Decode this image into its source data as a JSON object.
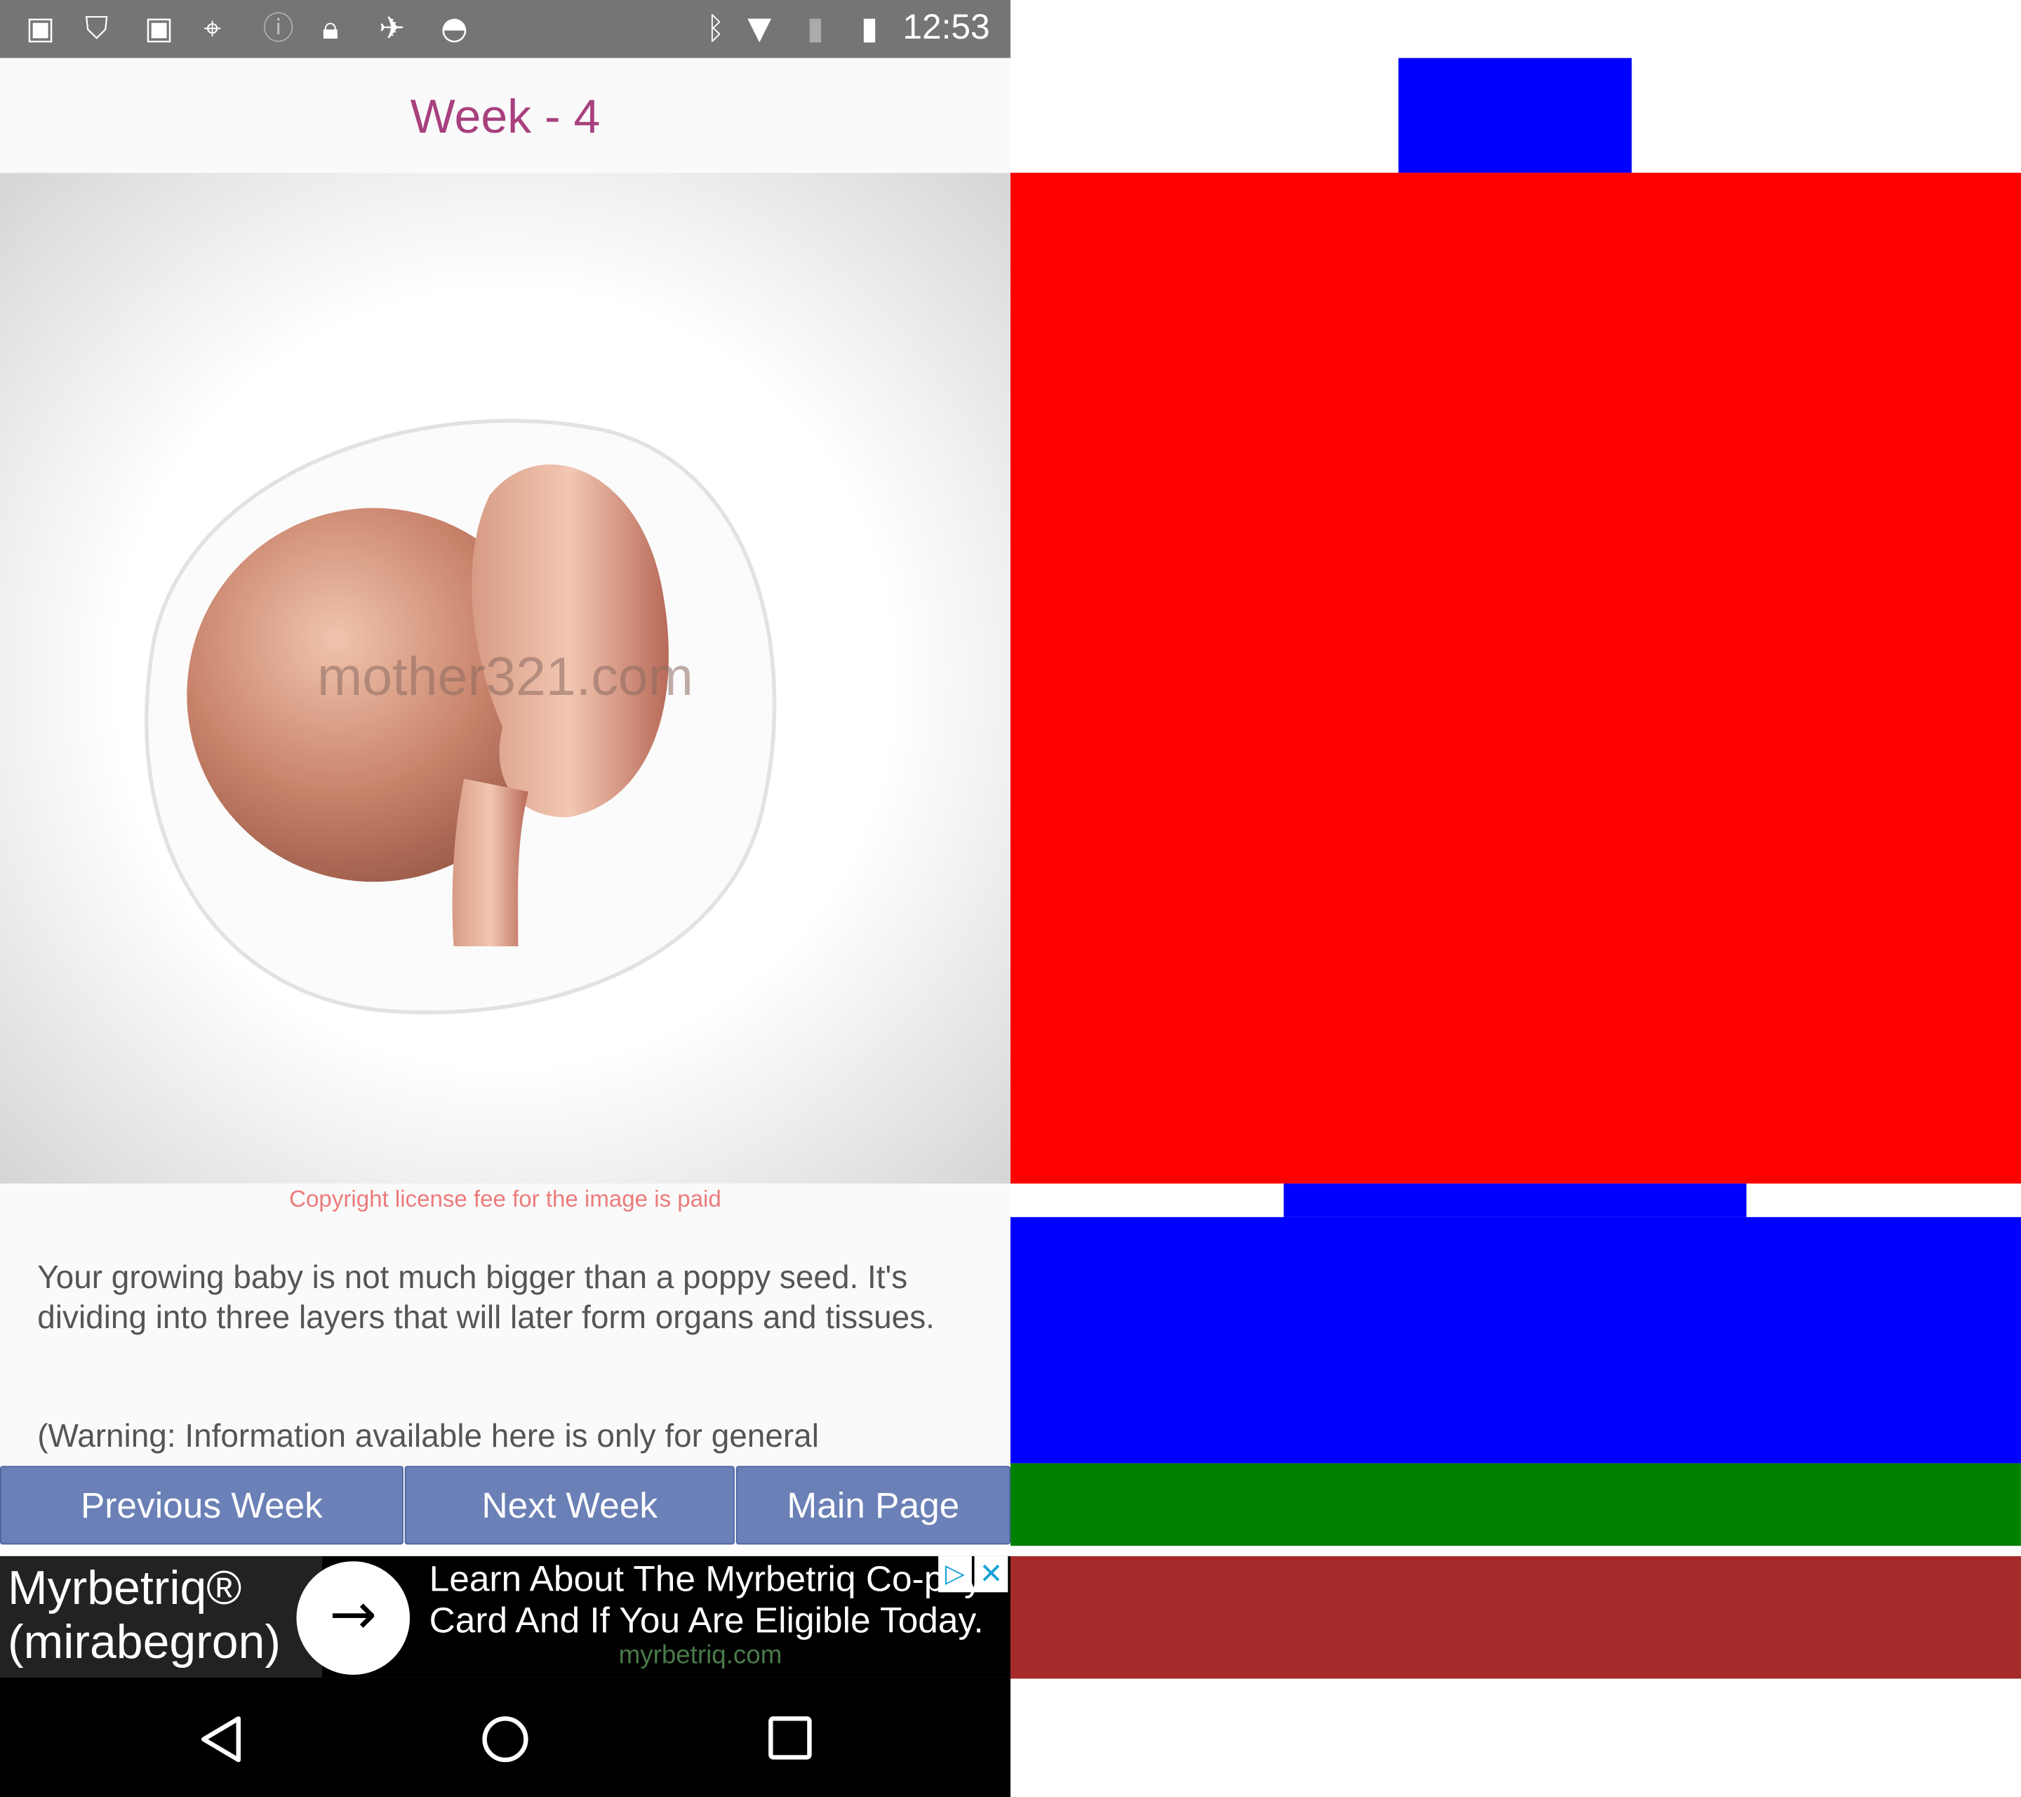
{
  "status_bar": {
    "icons": [
      "facebook-icon",
      "shield-icon",
      "facebook-icon",
      "maps-icon",
      "info-icon",
      "lock-icon",
      "fake-gps-icon",
      "android-icon",
      "bluetooth-icon",
      "wifi-icon",
      "no-sim-icon",
      "battery-charging-icon"
    ],
    "time": "12:53",
    "color": "#757575"
  },
  "header": {
    "title": "Week - 4",
    "title_color": "#a8407e"
  },
  "image": {
    "watermark": "mother321.com",
    "copyright": "Copyright license fee for the image is paid"
  },
  "content": {
    "description": "Your growing baby is not much bigger than a poppy seed. It's dividing into three layers that will later form organs and tissues.",
    "warning": "(Warning: Information available here is only for general"
  },
  "buttons": {
    "previous": "Previous Week",
    "next": "Next Week",
    "main": "Main Page",
    "color": "#6a80b6"
  },
  "ad": {
    "name": "Myrbetriq®\n(mirabegron)",
    "text_line1": "Learn About The Myrbetriq Co-pay",
    "text_line2": "Card And If You Are Eligible Today.",
    "url": "myrbetriq.com",
    "adchoices": "▷",
    "close": "✕"
  },
  "nav_bar": {
    "icons": [
      "back-icon",
      "home-icon",
      "recents-icon"
    ]
  },
  "overlay_colors": {
    "blue": "#0000ff",
    "red": "#ff0000",
    "green": "#008000",
    "brown": "#a52a2a"
  }
}
